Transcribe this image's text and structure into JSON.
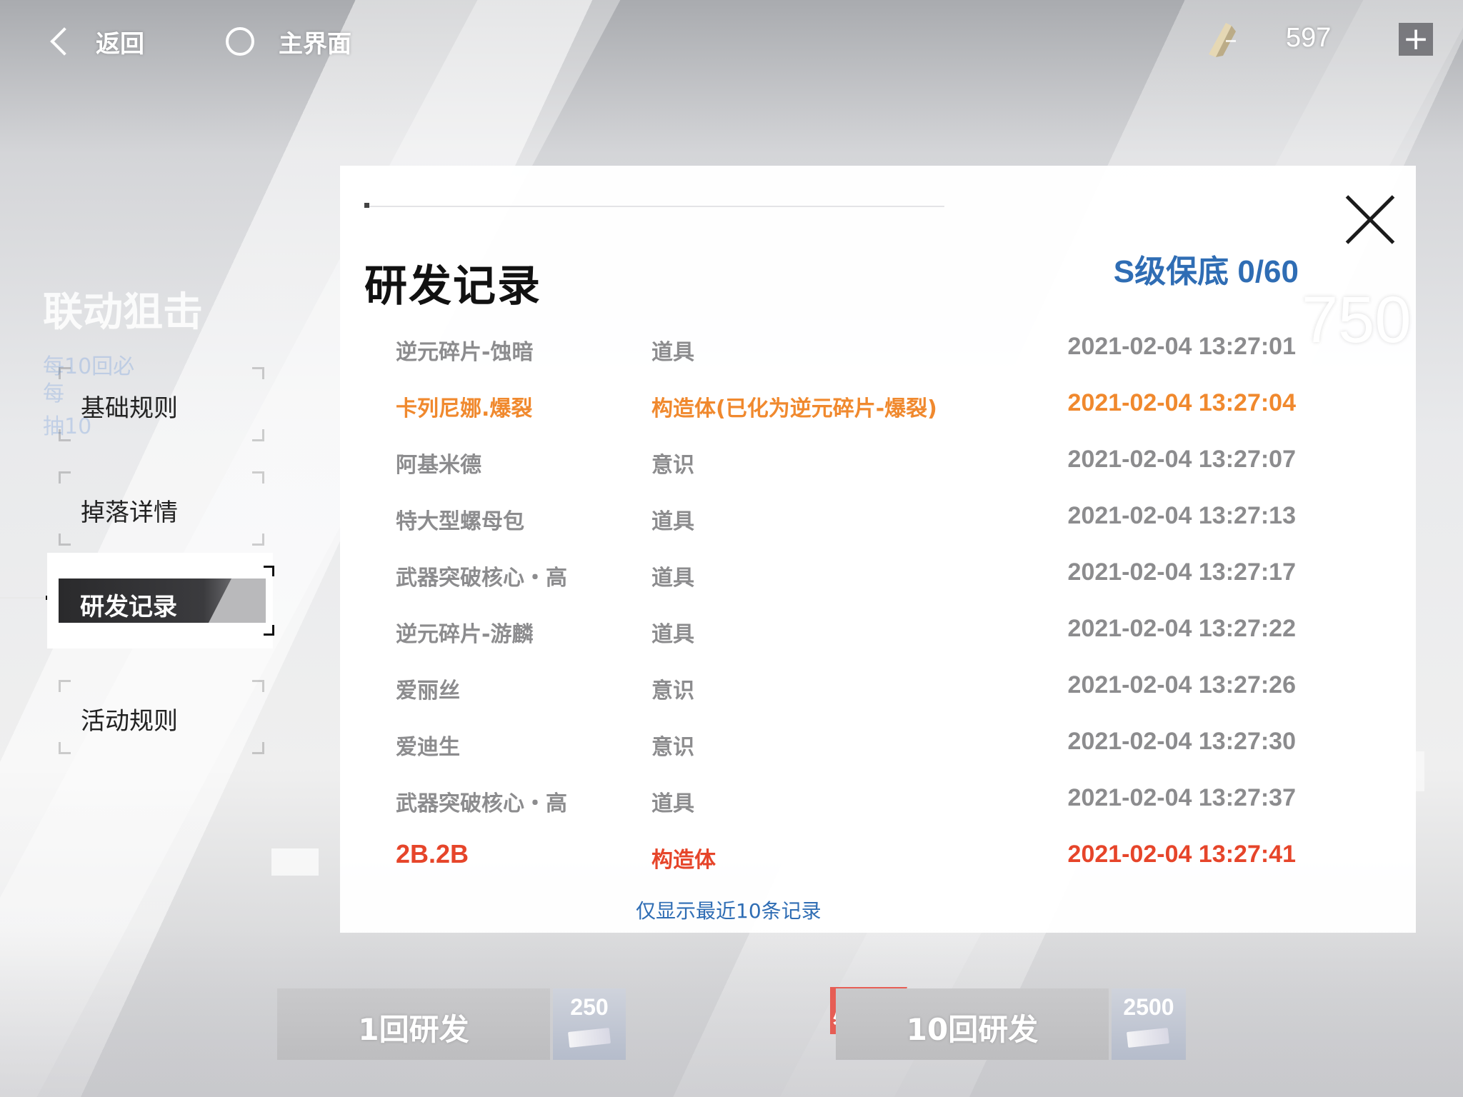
{
  "topbar": {
    "back_label": "返回",
    "home_label": "主界面",
    "currency_icon": "crystal-icon",
    "currency_value": "597",
    "add_label": "+"
  },
  "background": {
    "event_title": "联动狙击",
    "event_lines": [
      "每10回必",
      "每",
      "抽10"
    ]
  },
  "menu": {
    "items": [
      {
        "label": "基础规则"
      },
      {
        "label": "掉落详情"
      },
      {
        "label": "研发记录",
        "active": true
      },
      {
        "label": "活动规则"
      }
    ]
  },
  "panel": {
    "title": "研发记录",
    "guarantee": "S级保底 0/60",
    "big_number": "750",
    "close_icon": "close-icon",
    "note": "仅显示最近10条记录"
  },
  "records": [
    {
      "name": "逆元碎片-蚀暗",
      "type": "道具",
      "time": "2021-02-04 13:27:01",
      "rarity": "normal"
    },
    {
      "name": "卡列尼娜.爆裂",
      "type": "构造体(已化为逆元碎片-爆裂)",
      "time": "2021-02-04 13:27:04",
      "rarity": "orange"
    },
    {
      "name": "阿基米德",
      "type": "意识",
      "time": "2021-02-04 13:27:07",
      "rarity": "normal"
    },
    {
      "name": "特大型螺母包",
      "type": "道具",
      "time": "2021-02-04 13:27:13",
      "rarity": "normal"
    },
    {
      "name": "武器突破核心・高",
      "type": "道具",
      "time": "2021-02-04 13:27:17",
      "rarity": "normal"
    },
    {
      "name": "逆元碎片-游麟",
      "type": "道具",
      "time": "2021-02-04 13:27:22",
      "rarity": "normal"
    },
    {
      "name": "爱丽丝",
      "type": "意识",
      "time": "2021-02-04 13:27:26",
      "rarity": "normal"
    },
    {
      "name": "爱迪生",
      "type": "意识",
      "time": "2021-02-04 13:27:30",
      "rarity": "normal"
    },
    {
      "name": "武器突破核心・高",
      "type": "道具",
      "time": "2021-02-04 13:27:37",
      "rarity": "normal"
    },
    {
      "name": "2B.2B",
      "type": "构造体",
      "time": "2021-02-04 13:27:41",
      "rarity": "red"
    }
  ],
  "bottom": {
    "single_draw_label": "1回研发",
    "single_cost": "250",
    "ten_draw_label": "10回研发",
    "ten_cost": "2500",
    "guarantee_tag": "必出",
    "ticket_icon": "ticket-icon"
  },
  "colors": {
    "accent_blue": "#2f6db4",
    "rarity_orange": "#f0892e",
    "rarity_red": "#e6452a",
    "normal_gray": "#8c8c8e"
  }
}
